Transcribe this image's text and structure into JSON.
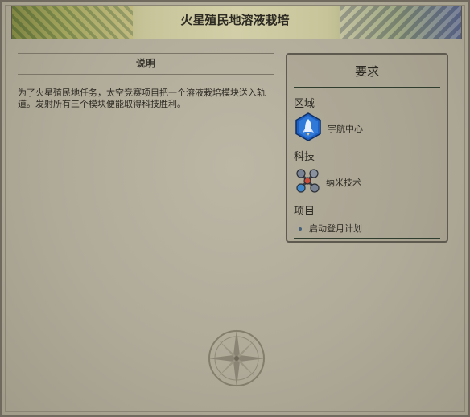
{
  "header": {
    "title": "火星殖民地溶液栽培"
  },
  "description": {
    "heading": "说明",
    "text": "为了火星殖民地任务，太空竞赛项目把一个溶液栽培模块送入轨道。发射所有三个模块便能取得科技胜利。"
  },
  "requirements": {
    "title": "要求",
    "district": {
      "label": "区域",
      "icon": "rocket-district-icon",
      "name": "宇航中心"
    },
    "tech": {
      "label": "科技",
      "icon": "nanotech-molecule-icon",
      "name": "纳米技术"
    },
    "project": {
      "label": "项目",
      "items": [
        "启动登月计划"
      ]
    }
  },
  "colors": {
    "accent_rule": "#2f3d2f",
    "district_badge": "#1f5fbf",
    "bullet": "#46607a"
  }
}
